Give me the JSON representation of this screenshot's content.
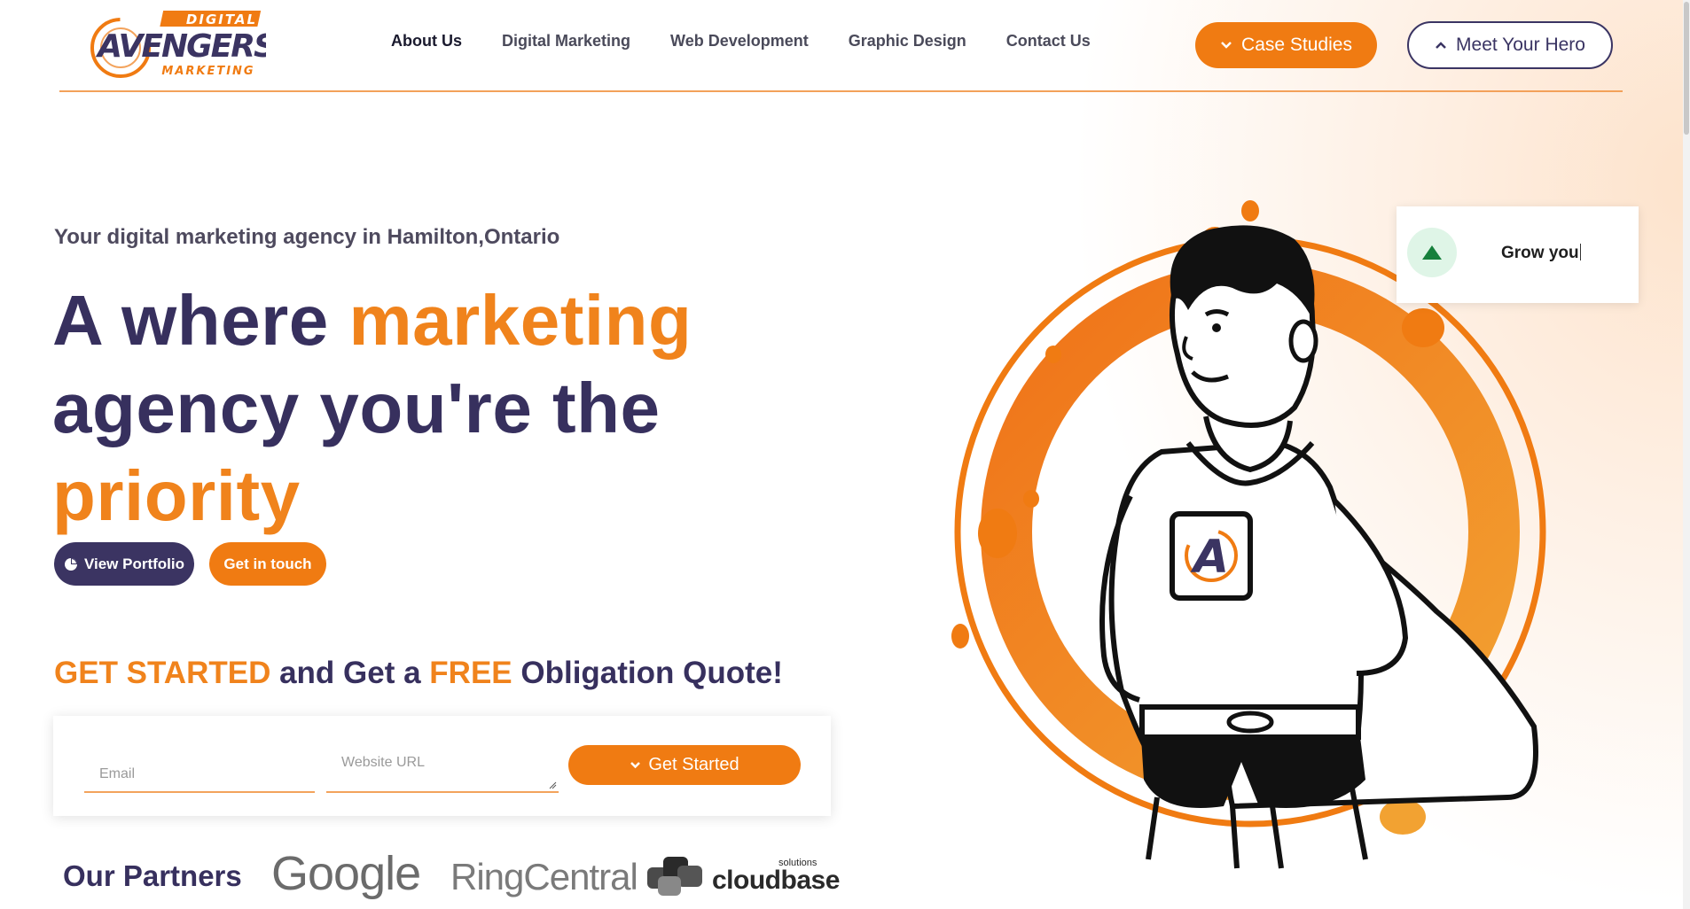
{
  "brand": {
    "logo_top": "DIGITAL",
    "logo_main": "AVENGERS",
    "logo_bottom": "MARKETING",
    "colors": {
      "navy": "#3b3462",
      "orange": "#f07b12",
      "orange_light": "#f3a35c"
    }
  },
  "nav": {
    "items": [
      {
        "label": "About Us",
        "active": true
      },
      {
        "label": "Digital Marketing"
      },
      {
        "label": "Web Development"
      },
      {
        "label": "Graphic Design"
      },
      {
        "label": "Contact Us"
      }
    ],
    "case_studies_label": "Case Studies",
    "case_studies_icon": "chevron-down-icon",
    "meet_hero_label": "Meet Your Hero",
    "meet_hero_icon": "chevron-up-icon"
  },
  "hero": {
    "tagline": "Your digital marketing agency in Hamilton,Ontario",
    "headline_1": "A where ",
    "headline_2": "marketing",
    "headline_3": "agency you're the",
    "headline_4": "priority",
    "view_portfolio_label": "View Portfolio",
    "portfolio_icon": "pie-chart-icon",
    "get_in_touch_label": "Get in touch"
  },
  "quote": {
    "part1": "GET STARTED",
    "part2": " and Get a ",
    "part3": "FREE",
    "part4": " Obligation Quote!",
    "email_placeholder": "Email",
    "url_placeholder": "Website URL",
    "email_value": "",
    "url_value": "",
    "submit_label": "Get Started",
    "submit_icon": "chevron-down-icon"
  },
  "partners": {
    "title": "Our Partners",
    "logos": [
      "Google",
      "RingCentral",
      "cloudbase"
    ],
    "cloudbase_sub": "solutions"
  },
  "grow_card": {
    "text": "Grow you",
    "icon": "arrow-up-triangle-icon"
  }
}
